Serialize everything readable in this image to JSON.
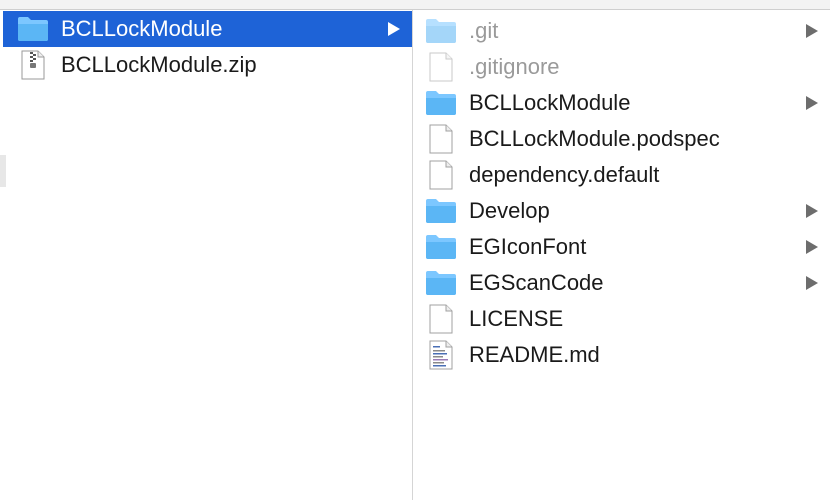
{
  "left_column": {
    "items": [
      {
        "label": "BCLLockModule",
        "icon": "folder-icon",
        "selected": true,
        "has_children": true
      },
      {
        "label": "BCLLockModule.zip",
        "icon": "zip-file-icon",
        "selected": false,
        "has_children": false
      }
    ]
  },
  "right_column": {
    "items": [
      {
        "label": ".git",
        "icon": "folder-icon",
        "hidden": true,
        "has_children": true
      },
      {
        "label": ".gitignore",
        "icon": "document-icon",
        "hidden": true,
        "has_children": false
      },
      {
        "label": "BCLLockModule",
        "icon": "folder-icon",
        "hidden": false,
        "has_children": true
      },
      {
        "label": "BCLLockModule.podspec",
        "icon": "document-icon",
        "hidden": false,
        "has_children": false
      },
      {
        "label": "dependency.default",
        "icon": "document-icon",
        "hidden": false,
        "has_children": false
      },
      {
        "label": "Develop",
        "icon": "folder-icon",
        "hidden": false,
        "has_children": true
      },
      {
        "label": "EGIconFont",
        "icon": "folder-icon",
        "hidden": false,
        "has_children": true
      },
      {
        "label": "EGScanCode",
        "icon": "folder-icon",
        "hidden": false,
        "has_children": true
      },
      {
        "label": "LICENSE",
        "icon": "document-icon",
        "hidden": false,
        "has_children": false
      },
      {
        "label": "README.md",
        "icon": "text-document-icon",
        "hidden": false,
        "has_children": false
      }
    ]
  },
  "colors": {
    "selection": "#1e63d7",
    "folder": "#5bb6f5",
    "arrow": "#6d6d6d"
  }
}
